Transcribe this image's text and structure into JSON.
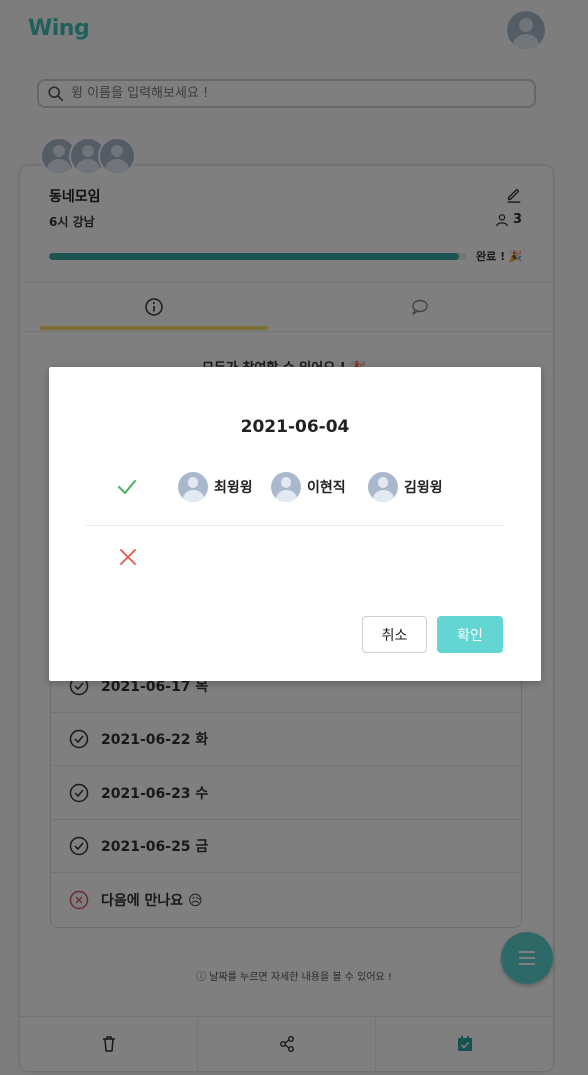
{
  "header": {
    "logo": "Wing",
    "avatar_icon": "user-avatar"
  },
  "search": {
    "placeholder": "윙 이름을 입력해보세요 !",
    "value": ""
  },
  "group": {
    "name": "동네모임",
    "subtitle": "6시 강남",
    "member_count": "3",
    "progress_fraction": 0.98,
    "progress_label": "완료 ! 🎉"
  },
  "tabs": [
    {
      "name": "info",
      "icon": "info-icon",
      "active": true
    },
    {
      "name": "chat",
      "icon": "chat-icon",
      "active": false
    }
  ],
  "vote_hint_behind": "모두가 참여할 수 있어요 ! 🎉",
  "dates": [
    {
      "label": "2021-06-17 목",
      "status": "yes"
    },
    {
      "label": "2021-06-22 화",
      "status": "yes"
    },
    {
      "label": "2021-06-23 수",
      "status": "yes"
    },
    {
      "label": "2021-06-25 금",
      "status": "yes"
    },
    {
      "label": "다음에 만나요 😥",
      "status": "no"
    }
  ],
  "date_hint": "ⓘ 날짜를 누르면 자세한 내용을 볼 수 있어요 !",
  "bottom_bar": [
    {
      "icon": "trash-icon"
    },
    {
      "icon": "share-icon"
    },
    {
      "icon": "calendar-check-icon"
    }
  ],
  "fab_icon": "menu-icon",
  "modal": {
    "date": "2021-06-04",
    "yes_voters": [
      "최윙윙",
      "이현직",
      "김윙윙"
    ],
    "no_voters": [],
    "cancel_label": "취소",
    "ok_label": "확인"
  },
  "colors": {
    "brand": "#3fbfb8",
    "progress": "#39a9a2",
    "tab_underline": "#f5e16a",
    "ok_button": "#63d6d3",
    "yes": "#4caf63",
    "no": "#e0594a"
  }
}
